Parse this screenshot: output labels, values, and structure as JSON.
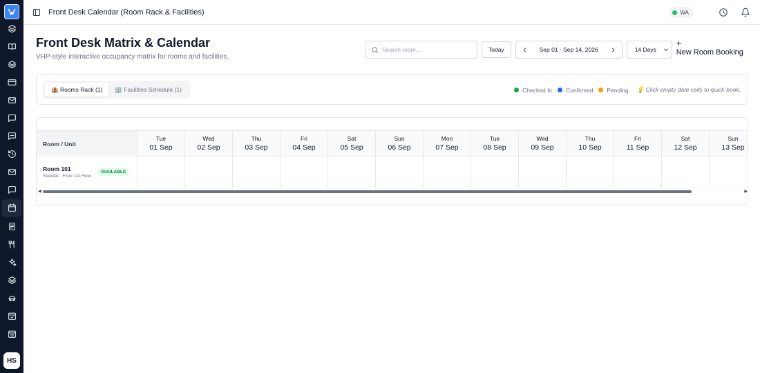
{
  "app": {
    "window_title": "Front Desk Calendar (Room Rack & Facilities)",
    "avatar_initials": "HS",
    "wa_status": "WA",
    "wa_status_color": "#22c55e"
  },
  "sidebar": {
    "items": [
      {
        "icon": "layers-icon",
        "active": false
      },
      {
        "icon": "book-open-icon",
        "active": false
      },
      {
        "icon": "stack-icon",
        "active": false
      },
      {
        "icon": "credit-card-icon",
        "active": false
      },
      {
        "icon": "mail-icon",
        "active": false
      },
      {
        "icon": "message-icon",
        "active": false
      },
      {
        "icon": "chat-icon",
        "active": false
      },
      {
        "icon": "history-icon",
        "active": false
      },
      {
        "icon": "inbox-icon",
        "active": false
      },
      {
        "icon": "comment-icon",
        "active": false
      },
      {
        "icon": "calendar-icon",
        "active": true
      },
      {
        "icon": "receipt-icon",
        "active": false
      },
      {
        "icon": "utensils-icon",
        "active": false
      },
      {
        "icon": "sparkles-icon",
        "active": false
      },
      {
        "icon": "layers-alt-icon",
        "active": false
      },
      {
        "icon": "car-icon",
        "active": false
      },
      {
        "icon": "calendar-check-icon",
        "active": false
      },
      {
        "icon": "calendar-grid-icon",
        "active": false
      }
    ]
  },
  "header": {
    "title": "Front Desk Matrix & Calendar",
    "subtitle": "VHP-style interactive occupancy matrix for rooms and facilities."
  },
  "toolbar": {
    "search_placeholder": "Search room...",
    "today_label": "Today",
    "date_range": "Sep 01 - Sep 14, 2026",
    "view_selected": "14 Days",
    "new_booking_plus": "+",
    "new_booking_label": "New Room Booking"
  },
  "tabs": [
    {
      "label": "🏨 Rooms Rack (1)",
      "active": true
    },
    {
      "label": "🏢 Facilities Schedule (1)",
      "active": false
    }
  ],
  "legend": {
    "items": [
      {
        "label": "Checked In",
        "color": "#16a34a"
      },
      {
        "label": "Confirmed",
        "color": "#2563eb"
      },
      {
        "label": "Pending",
        "color": "#f59e0b"
      }
    ],
    "hint": "💡 Click empty date cells to quick-book."
  },
  "grid": {
    "room_header": "Room / Unit",
    "days": [
      {
        "dow": "Tue",
        "date": "01 Sep"
      },
      {
        "dow": "Wed",
        "date": "02 Sep"
      },
      {
        "dow": "Thu",
        "date": "03 Sep"
      },
      {
        "dow": "Fri",
        "date": "04 Sep"
      },
      {
        "dow": "Sat",
        "date": "05 Sep"
      },
      {
        "dow": "Sun",
        "date": "06 Sep"
      },
      {
        "dow": "Mon",
        "date": "07 Sep"
      },
      {
        "dow": "Tue",
        "date": "08 Sep"
      },
      {
        "dow": "Wed",
        "date": "09 Sep"
      },
      {
        "dow": "Thu",
        "date": "10 Sep"
      },
      {
        "dow": "Fri",
        "date": "11 Sep"
      },
      {
        "dow": "Sat",
        "date": "12 Sep"
      },
      {
        "dow": "Sun",
        "date": "13 Sep"
      }
    ],
    "rooms": [
      {
        "name": "Room 101",
        "meta": "Standar - Floor 1st Floor",
        "status": "AVAILABLE"
      }
    ]
  }
}
